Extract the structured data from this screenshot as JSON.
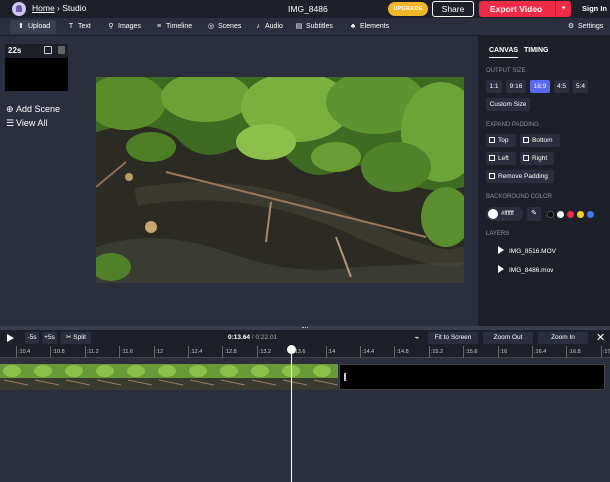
{
  "header": {
    "breadcrumb_home": "Home",
    "breadcrumb_sep": " › ",
    "breadcrumb_current": "Studio",
    "project_title": "IMG_8486",
    "upgrade_label": "UPGRADE",
    "share_label": "Share",
    "export_label": "Export Video",
    "export_caret": "▾",
    "signin_label": "Sign In"
  },
  "toolbar": {
    "items": [
      {
        "label": "Upload",
        "icon": "upload-icon",
        "glyph": "⬆"
      },
      {
        "label": "Text",
        "icon": "text-icon",
        "glyph": "T"
      },
      {
        "label": "Images",
        "icon": "search-icon",
        "glyph": "⚲"
      },
      {
        "label": "Timeline",
        "icon": "timeline-icon",
        "glyph": "≡"
      },
      {
        "label": "Scenes",
        "icon": "scenes-icon",
        "glyph": "◎"
      },
      {
        "label": "Audio",
        "icon": "music-icon",
        "glyph": "♪"
      },
      {
        "label": "Subtitles",
        "icon": "subtitles-icon",
        "glyph": "▤"
      },
      {
        "label": "Elements",
        "icon": "elements-icon",
        "glyph": "♣"
      }
    ],
    "settings_label": "Settings"
  },
  "scenes": {
    "duration": "22s",
    "add_scene_label": "Add Scene",
    "view_all_label": "View All"
  },
  "right_panel": {
    "tabs": [
      "CANVAS",
      "TIMING"
    ],
    "output_size_label": "OUTPUT SIZE",
    "sizes": [
      "1:1",
      "9:16",
      "16:9",
      "4:5",
      "5:4"
    ],
    "selected_size": "16:9",
    "custom_size_label": "Custom Size",
    "expand_padding_label": "EXPAND PADDING",
    "padding": {
      "top": "Top",
      "bottom": "Bottom",
      "left": "Left",
      "right": "Right",
      "remove": "Remove Padding"
    },
    "background_color_label": "BACKGROUND COLOR",
    "background_hex": "#ffffff",
    "swatches": [
      "#000000",
      "#ffffff",
      "#ee2b46",
      "#f5d31a",
      "#3a7bf0"
    ],
    "layers_label": "LAYERS",
    "layers": [
      "IMG_8516.MOV",
      "IMG_8486.mov"
    ]
  },
  "timeline": {
    "back_label": "-5s",
    "forward_label": "+5s",
    "split_label": "Split",
    "current_time": "0:13.64",
    "time_sep": " / ",
    "total_time": "0:22.01",
    "fit_label": "Fit to Screen",
    "zoom_out_label": "Zoom Out",
    "zoom_in_label": "Zoom In",
    "ruler": [
      ":10.4",
      ":10.8",
      ":11.2",
      ":11.6",
      ":12",
      ":12.4",
      ":12.8",
      ":13.2",
      ":13.6",
      ":14",
      ":14.4",
      ":14.8",
      ":15.2",
      ":15.6",
      ":16",
      ":16.4",
      ":16.8",
      ":17.2"
    ],
    "playhead_time": 13.64
  },
  "colors": {
    "accent": "#5a6af0",
    "export": "#ee2b46",
    "upgrade": "#f1b52a",
    "panel_dark": "#1d2029",
    "panel": "#2b2f3d"
  }
}
